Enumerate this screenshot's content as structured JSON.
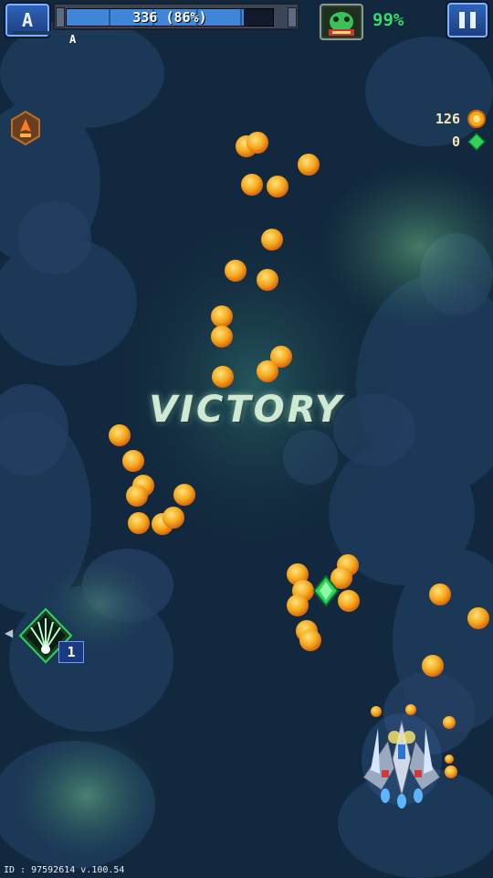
{
  "hud": {
    "rank_button_label": "A",
    "hp_text": "336 (86%)",
    "hp_fraction": 0.86,
    "rank_letter": "A",
    "boss_progress_text": "99%",
    "pause_icon": "pause-icon",
    "coins": "126",
    "gems": "0",
    "colors": {
      "hp_fill": "#3d86d8",
      "boss_percent": "#37d96a",
      "button_blue": "#2f63b8",
      "coin_gold": "#f4a81c",
      "gem_green": "#2fd35a"
    }
  },
  "center_message": "VICTORY",
  "skill": {
    "icon": "lightning-burst-icon",
    "count": "1"
  },
  "player_ship": "fighter-ship-icon",
  "build_info": "ID : 97592614 v.100.54"
}
